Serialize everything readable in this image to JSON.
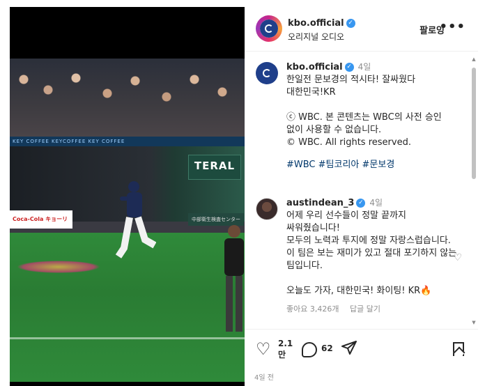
{
  "post": {
    "username": "kbo.official",
    "subtitle": "오리지널 오디오",
    "follow_label": "팔로잉",
    "more_label": "•••"
  },
  "video": {
    "banner_text": "KEY COFFEE   KEYCOFFEE   KEY COFFEE",
    "teral_text": "TERAL",
    "ad_left_text": "Coca-Cola  キョーリン製薬",
    "ad_right_text": "中部衛生検査センター"
  },
  "caption": {
    "username": "kbo.official",
    "time": "4일",
    "text": "한일전 문보경의 적시타! 잘싸웠다 대한민국!KR\n\nⓒ WBC. 본 콘텐츠는 WBC의 사전 승인 없이 사용할 수 없습니다.\n© WBC. All rights reserved.",
    "hashtags": "#WBC #팀코리아 #문보경"
  },
  "comment": {
    "username": "austindean_3",
    "time": "4일",
    "text": "어제 우리 선수들이 정말 끝까지 싸워줬습니다!\n모두의 노력과 투지에 정말 자랑스럽습니다.\n이 팀은 보는 재미가 있고 절대 포기하지 않는 팀입니다.\n\n오늘도 가자, 대한민국! 화이팅! KR🔥",
    "likes": "좋아요 3,426개",
    "reply": "답글 달기"
  },
  "actions": {
    "like_count": "2.1만",
    "comment_count": "62",
    "date": "4일 전"
  },
  "colors": {
    "hashtag": "#00376b",
    "verified": "#3897f0",
    "kbo_blue": "#1f3f8a"
  },
  "icons": [
    "verified-icon",
    "heart-icon",
    "comment-icon",
    "share-icon",
    "bookmark-icon",
    "more-icon"
  ]
}
